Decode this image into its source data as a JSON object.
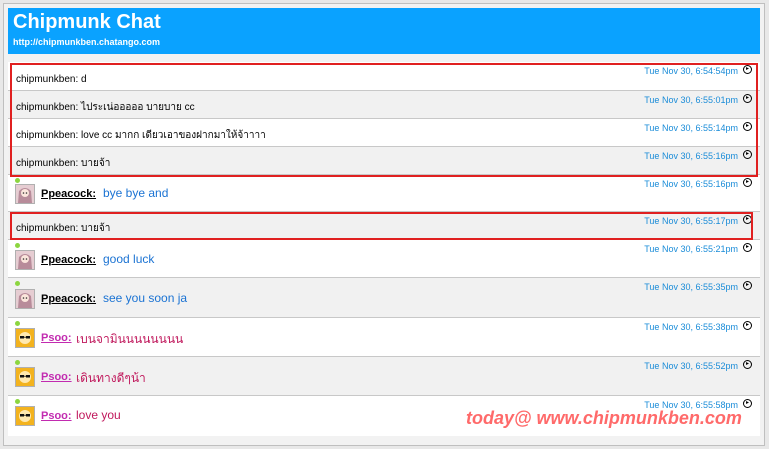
{
  "header": {
    "title": "Chipmunk Chat",
    "url": "http://chipmunkben.chatango.com"
  },
  "messages": [
    {
      "user": "chipmunkben",
      "text": "chipmunkben: d",
      "time": "Tue Nov 30, 6:54:54pm"
    },
    {
      "user": "chipmunkben",
      "text": "chipmunkben: ไประเน่อออออ บายบาย cc",
      "time": "Tue Nov 30, 6:55:01pm"
    },
    {
      "user": "chipmunkben",
      "text": "chipmunkben: love cc มากก เดียวเอาของฝากมาให้จ้าาาา",
      "time": "Tue Nov 30, 6:55:14pm"
    },
    {
      "user": "chipmunkben",
      "text": "chipmunkben: บายจ้า",
      "time": "Tue Nov 30, 6:55:16pm"
    },
    {
      "user": "Ppeacock",
      "name": "Ppeacock:",
      "text": "bye bye and",
      "time": "Tue Nov 30, 6:55:16pm"
    },
    {
      "user": "chipmunkben",
      "text": "chipmunkben: บายจ้า",
      "time": "Tue Nov 30, 6:55:17pm"
    },
    {
      "user": "Ppeacock",
      "name": "Ppeacock:",
      "text": "good luck",
      "time": "Tue Nov 30, 6:55:21pm"
    },
    {
      "user": "Ppeacock",
      "name": "Ppeacock:",
      "text": "see you soon ja",
      "time": "Tue Nov 30, 6:55:35pm"
    },
    {
      "user": "Psoo",
      "name": "Psoo:",
      "text": "เบนจามินนนนนนนน",
      "time": "Tue Nov 30, 6:55:38pm"
    },
    {
      "user": "Psoo",
      "name": "Psoo:",
      "text": "เดินทางดีๆน้า",
      "time": "Tue Nov 30, 6:55:52pm"
    },
    {
      "user": "Psoo",
      "name": "Psoo:",
      "text": "love you",
      "time": "Tue Nov 30, 6:55:58pm"
    }
  ],
  "watermark": "today@ www.chipmunkben.com",
  "colors": {
    "header_bg": "#0aa2ff",
    "timestamp": "#1a8cd8",
    "highlight_border": "#e02020",
    "ppeacock_text": "#1b73d3",
    "psoo_name": "#c22bb0",
    "psoo_text": "#c0185c",
    "online_dot": "#8cd640"
  },
  "icons": {
    "message_action": "circled-arrow-icon",
    "ppeacock_avatar": "anime-girl-avatar",
    "psoo_avatar": "cartoon-sunglasses-avatar"
  }
}
